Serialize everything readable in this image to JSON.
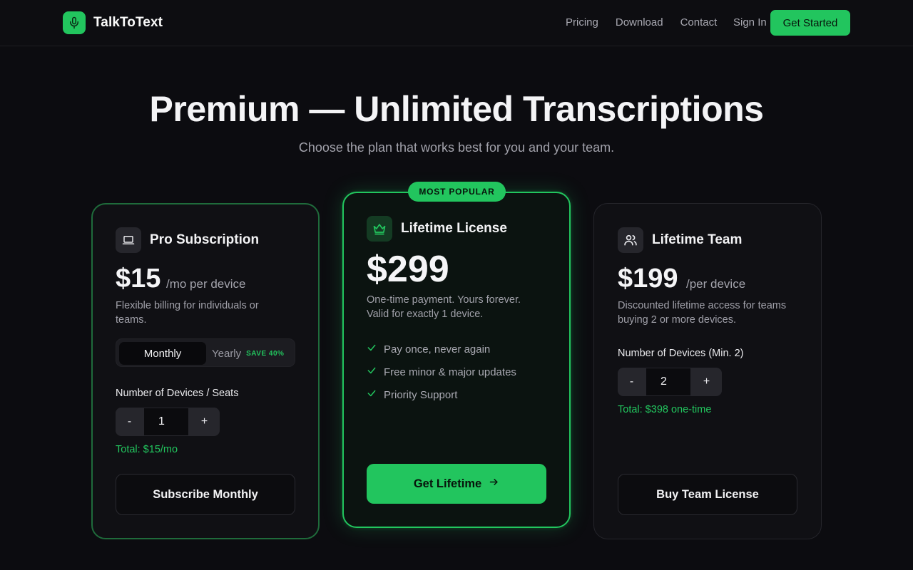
{
  "brand": {
    "name": "TalkToText",
    "accent": "#22c55e"
  },
  "nav": {
    "links": [
      "Pricing",
      "Download",
      "Contact"
    ],
    "signin": "Sign In",
    "cta": "Get Started"
  },
  "hero": {
    "title": "Premium — Unlimited Transcriptions",
    "subtitle": "Choose the plan that works best for you and your team."
  },
  "plans": {
    "pro": {
      "icon": "laptop-icon",
      "title": "Pro Subscription",
      "price": "$15",
      "unit": "/mo per device",
      "description": "Flexible billing for individuals or teams.",
      "billing_toggle": {
        "monthly": "Monthly",
        "yearly": "Yearly",
        "save": "SAVE 40%",
        "selected": "Monthly"
      },
      "devices_label": "Number of Devices / Seats",
      "minus": "-",
      "plus": "+",
      "quantity": "1",
      "total": "Total: $15/mo",
      "button": "Subscribe Monthly"
    },
    "lifetime": {
      "badge": "MOST POPULAR",
      "icon": "crown-icon",
      "title": "Lifetime License",
      "price": "$299",
      "description": "One-time payment. Yours forever. Valid for exactly 1 device.",
      "features": [
        "Pay once, never again",
        "Free minor & major updates",
        "Priority Support"
      ],
      "button": "Get Lifetime"
    },
    "team": {
      "icon": "users-icon",
      "title": "Lifetime Team",
      "price": "$199",
      "unit": "/per device",
      "description": "Discounted lifetime access for teams buying 2 or more devices.",
      "devices_label": "Number of Devices (Min. 2)",
      "minus": "-",
      "plus": "+",
      "quantity": "2",
      "total": "Total: $398 one-time",
      "button": "Buy Team License"
    }
  }
}
